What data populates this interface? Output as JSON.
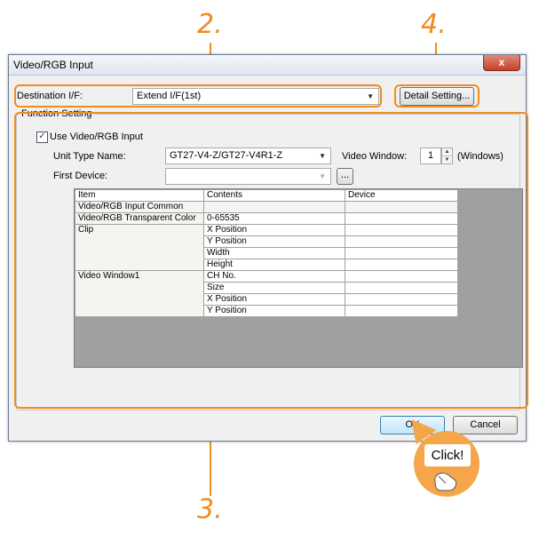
{
  "callouts": {
    "c2": "2.",
    "c4": "4.",
    "c3": "3."
  },
  "window": {
    "title": "Video/RGB Input",
    "close_glyph": "x"
  },
  "destination": {
    "label": "Destination I/F:",
    "value": "Extend I/F(1st)"
  },
  "detail_button": "Detail Setting...",
  "function_setting": {
    "group_label": "Function Setting",
    "use_checkbox_label": "Use Video/RGB Input",
    "use_checked": true,
    "unit_type_label": "Unit Type Name:",
    "unit_type_value": "GT27-V4-Z/GT27-V4R1-Z",
    "video_window_label": "Video Window:",
    "video_window_value": "1",
    "video_window_unit": "(Windows)",
    "first_device_label": "First Device:",
    "first_device_value": "",
    "browse_button": "..."
  },
  "table": {
    "headers": [
      "Item",
      "Contents",
      "Device"
    ],
    "rows": [
      {
        "item": "Video/RGB Input Common",
        "contents": "",
        "device": ""
      },
      {
        "item": "Video/RGB Transparent Color",
        "contents": "0-65535",
        "device": ""
      },
      {
        "item": "Clip",
        "contents": "X Position",
        "device": ""
      },
      {
        "item": "",
        "contents": "Y Position",
        "device": ""
      },
      {
        "item": "",
        "contents": "Width",
        "device": ""
      },
      {
        "item": "",
        "contents": "Height",
        "device": ""
      },
      {
        "item": "Video Window1",
        "contents": "CH No.",
        "device": ""
      },
      {
        "item": "",
        "contents": "Size",
        "device": ""
      },
      {
        "item": "",
        "contents": "X Position",
        "device": ""
      },
      {
        "item": "",
        "contents": "Y Position",
        "device": ""
      }
    ]
  },
  "buttons": {
    "ok": "OK",
    "cancel": "Cancel"
  },
  "click_bubble": "Click!",
  "colors": {
    "accent": "#f08c1e",
    "bubble": "#f5a64a"
  }
}
